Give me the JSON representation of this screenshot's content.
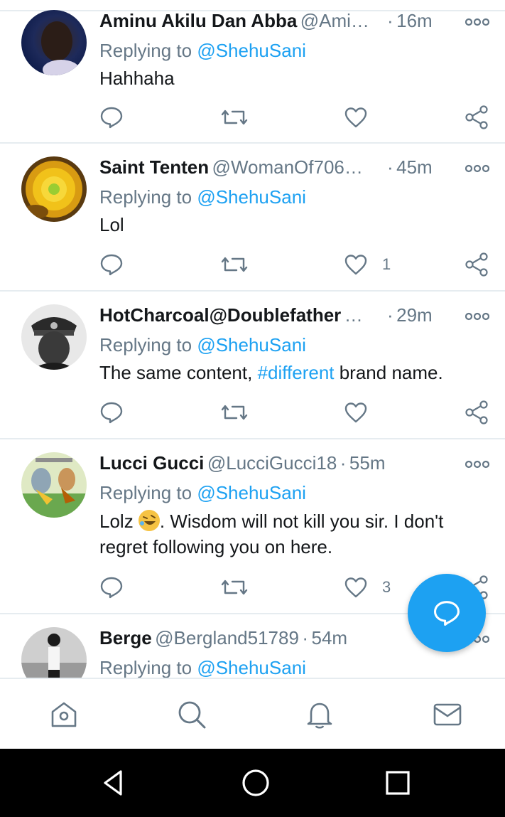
{
  "tweets": [
    {
      "name": "Aminu Akilu Dan Abba",
      "handle": "@Ami…",
      "time": "16m",
      "replying_prefix": "Replying to ",
      "replying_to": "@ShehuSani",
      "text": "Hahhaha",
      "likes": ""
    },
    {
      "name": "Saint Tenten",
      "handle": "@WomanOf706…",
      "time": "45m",
      "replying_prefix": "Replying to ",
      "replying_to": "@ShehuSani",
      "text": "Lol",
      "likes": "1"
    },
    {
      "name": "HotCharcoal@Doublefather",
      "handle": "…",
      "time": "29m",
      "replying_prefix": "Replying to ",
      "replying_to": "@ShehuSani",
      "text_before": "The same content, ",
      "hashtag": "#different",
      "text_after": " brand name.",
      "likes": ""
    },
    {
      "name": "Lucci Gucci",
      "handle": "@LucciGucci18",
      "time": "55m",
      "replying_prefix": "Replying to ",
      "replying_to": "@ShehuSani",
      "text_before": "Lolz ",
      "text_after": ". Wisdom will not kill you sir. I don't regret following you on here.",
      "likes": "3"
    },
    {
      "name": "Berge",
      "handle": "@Bergland51789",
      "time": "54m",
      "replying_prefix": "Replying to ",
      "replying_to": "@ShehuSani"
    }
  ],
  "separator": "·",
  "icons": {
    "more": "more-dots-icon",
    "reply": "reply-bubble-icon",
    "retweet": "retweet-icon",
    "like": "heart-icon",
    "share": "share-icon",
    "compose": "compose-reply-icon",
    "nav_home": "home-icon",
    "nav_search": "search-icon",
    "nav_notifications": "bell-icon",
    "nav_messages": "mail-icon",
    "sys_back": "triangle-back-icon",
    "sys_home": "circle-home-icon",
    "sys_recents": "square-recents-icon"
  },
  "colors": {
    "accent": "#1da1f2",
    "text": "#14171a",
    "muted": "#657786",
    "divider": "#e6ecf0"
  }
}
